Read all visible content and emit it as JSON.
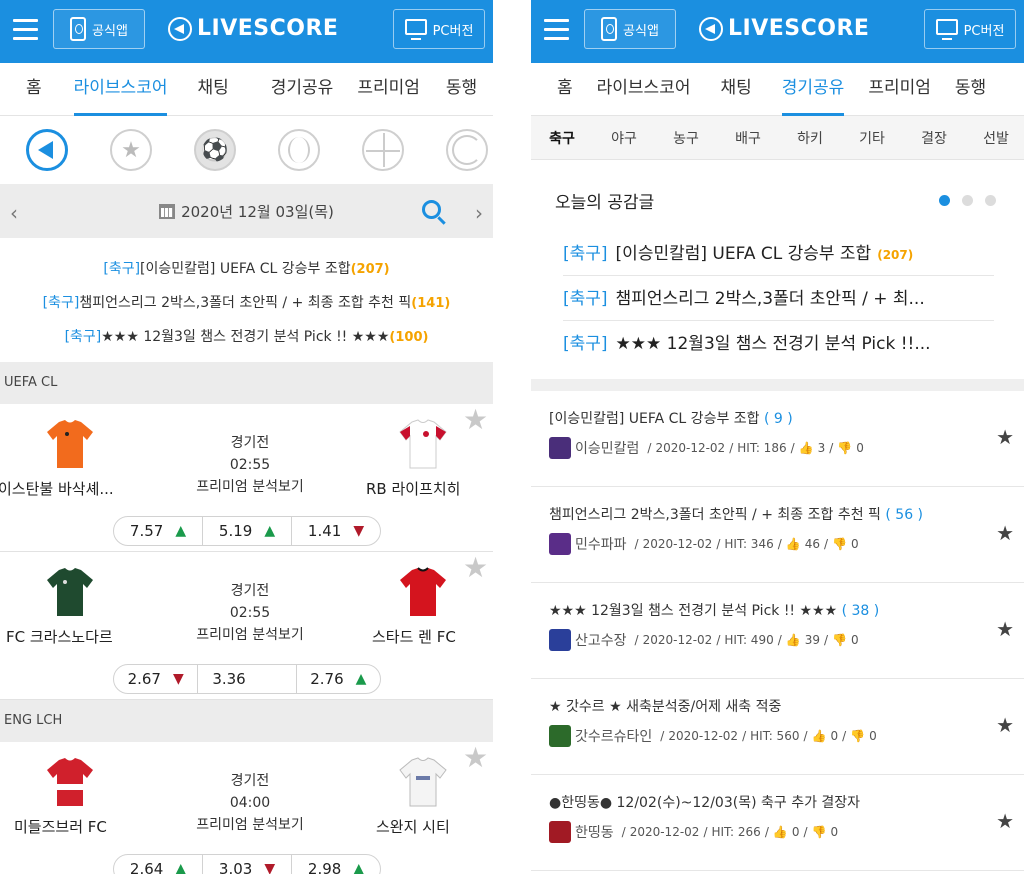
{
  "header": {
    "app_label": "공식앱",
    "logo_text": "LIVESCORE",
    "pc_label": "PC버전",
    "brand_color": "#1b8fe0"
  },
  "left": {
    "tabs": [
      "홈",
      "라이브스코어",
      "채팅",
      "경기공유",
      "프리미엄",
      "동행"
    ],
    "active_tab": "라이브스코어",
    "sports_icons": [
      "livescore-icon",
      "favorite-star-icon",
      "soccer-ball-icon",
      "baseball-icon",
      "basketball-icon",
      "volleyball-icon"
    ],
    "date": "2020년 12월 03일(목)",
    "featured": [
      {
        "category": "[축구]",
        "title": "[이승민칼럼] UEFA CL 강승부 조합",
        "count": "(207)"
      },
      {
        "category": "[축구]",
        "title": "챔피언스리그 2박스,3폴더 초안픽 / + 최종 조합 추천 픽",
        "count": "(141)"
      },
      {
        "category": "[축구]",
        "title": "★★★ 12월3일 챔스 전경기 분석 Pick !! ★★★",
        "count": "(100)"
      }
    ],
    "leagues": [
      {
        "name": "UEFA CL",
        "matches": [
          {
            "home": "이스탄불 바삭셰...",
            "away": "RB 라이프치히",
            "status": "경기전",
            "time": "02:55",
            "premium": "프리미엄 분석보기",
            "odds": [
              "7.57",
              "5.19",
              "1.41"
            ],
            "dirs": [
              "up",
              "up",
              "down"
            ]
          },
          {
            "home": "FC 크라스노다르",
            "away": "스타드 렌 FC",
            "status": "경기전",
            "time": "02:55",
            "premium": "프리미엄 분석보기",
            "odds": [
              "2.67",
              "3.36",
              "2.76"
            ],
            "dirs": [
              "down",
              "",
              "up"
            ]
          }
        ]
      },
      {
        "name": "ENG LCH",
        "matches": [
          {
            "home": "미들즈브러 FC",
            "away": "스완지 시티",
            "status": "경기전",
            "time": "04:00",
            "premium": "프리미엄 분석보기",
            "odds": [
              "2.64",
              "3.03",
              "2.98"
            ],
            "dirs": [
              "up",
              "down",
              "up"
            ]
          }
        ]
      }
    ]
  },
  "right": {
    "tabs": [
      "홈",
      "라이브스코어",
      "채팅",
      "경기공유",
      "프리미엄",
      "동행"
    ],
    "active_tab": "경기공유",
    "sub_tabs": [
      "축구",
      "야구",
      "농구",
      "배구",
      "하키",
      "기타",
      "결장",
      "선발"
    ],
    "active_sub_tab": "축구",
    "hot_title": "오늘의 공감글",
    "hot_items": [
      {
        "category": "[축구]",
        "title": "[이승민칼럼] UEFA CL 강승부 조합",
        "count": "(207)"
      },
      {
        "category": "[축구]",
        "title": "챔피언스리그 2박스,3폴더 초안픽 / + 최...",
        "count": ""
      },
      {
        "category": "[축구]",
        "title": "★★★ 12월3일 챔스 전경기 분석 Pick !!...",
        "count": ""
      }
    ],
    "posts": [
      {
        "title": "[이승민칼럼] UEFA CL 강승부 조합",
        "comments": "( 9 )",
        "author": "이승민칼럼",
        "date": "2020-12-02",
        "hit": "HIT: 186",
        "likes": "3",
        "dislikes": "0",
        "avatar_color": "#4a2e7a"
      },
      {
        "title": "챔피언스리그 2박스,3폴더 초안픽 / + 최종 조합 추천 픽",
        "comments": "( 56 )",
        "author": "민수파파",
        "date": "2020-12-02",
        "hit": "HIT: 346",
        "likes": "46",
        "dislikes": "0",
        "avatar_color": "#5a2d88"
      },
      {
        "title": "★★★ 12월3일 챔스 전경기 분석 Pick !! ★★★",
        "comments": "( 38 )",
        "author": "산고수장",
        "date": "2020-12-02",
        "hit": "HIT: 490",
        "likes": "39",
        "dislikes": "0",
        "avatar_color": "#2a3f9a"
      },
      {
        "title": "★ 갓수르 ★ 새축분석중/어제 새축 적중",
        "comments": "",
        "author": "갓수르슈타인",
        "date": "2020-12-02",
        "hit": "HIT: 560",
        "likes": "0",
        "dislikes": "0",
        "avatar_color": "#2c6a2a"
      },
      {
        "title": "●한띵동● 12/02(수)~12/03(목) 축구 추가 결장자",
        "comments": "",
        "author": "한띵동",
        "date": "2020-12-02",
        "hit": "HIT: 266",
        "likes": "0",
        "dislikes": "0",
        "avatar_color": "#a11a24"
      }
    ]
  }
}
